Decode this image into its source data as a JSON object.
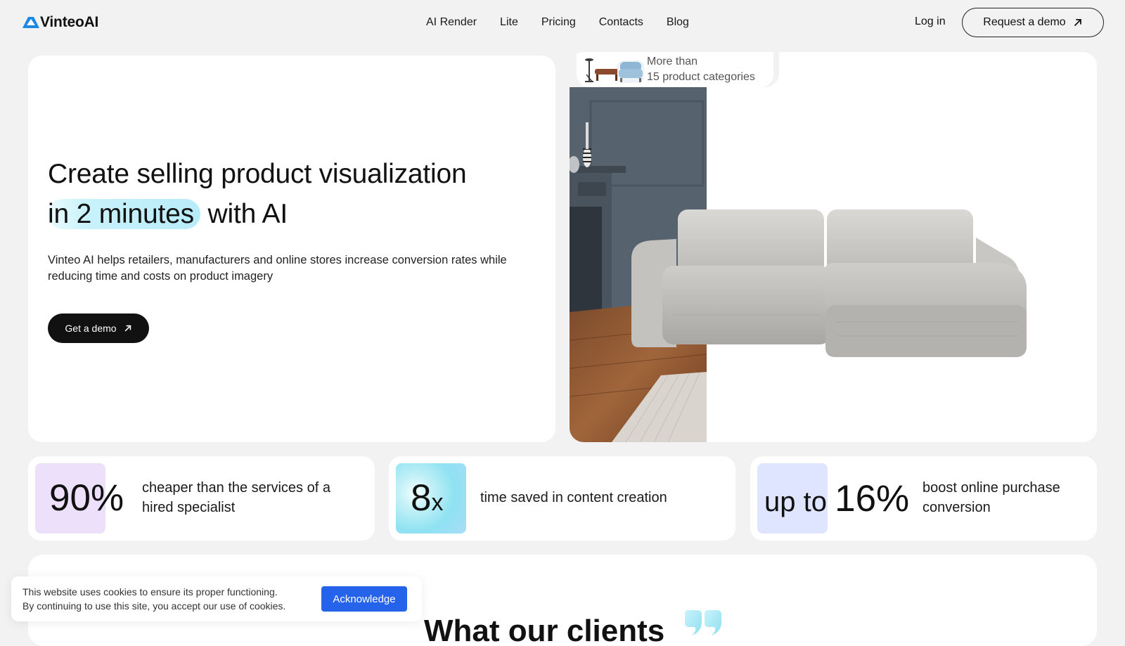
{
  "header": {
    "logo_text": "VinteoAI",
    "nav": [
      "AI Render",
      "Lite",
      "Pricing",
      "Contacts",
      "Blog"
    ],
    "login_label": "Log in",
    "demo_label": "Request a demo"
  },
  "hero": {
    "title_line1": "Create selling product visualization",
    "title_highlight": "in 2 minutes",
    "title_tail": "with AI",
    "subtitle": "Vinteo AI helps retailers, manufacturers and online stores increase conversion rates while reducing time and costs on product imagery",
    "cta_label": "Get a demo",
    "categories_line1": "More than",
    "categories_line2": "15 product categories"
  },
  "stats": [
    {
      "value": "90%",
      "description": "cheaper than the services of a hired specialist"
    },
    {
      "value_num": "8",
      "value_unit": "x",
      "description": "time saved in content creation"
    },
    {
      "value_prefix": "up to",
      "value_num": "16%",
      "description": "boost online purchase conversion"
    }
  ],
  "testimonials": {
    "heading_partial": "What our clients"
  },
  "cookie": {
    "line1": "This website uses cookies to ensure its proper functioning.",
    "line2": "By continuing to use this site, you accept our use of cookies.",
    "button_label": "Acknowledge"
  },
  "colors": {
    "page_bg": "#f2f2f3",
    "card_bg": "#ffffff",
    "dark_button": "#111111",
    "highlight": "#c9f2fb",
    "chip_purple": "#ece0fb",
    "chip_blue": "#dfe4ff",
    "cookie_button": "#2563eb",
    "logo_blue": "#1e88e5"
  },
  "icons": {
    "logo": "triangle-logo-icon",
    "cta_arrow": "arrow-up-right-icon",
    "quote": "quote-icon"
  }
}
